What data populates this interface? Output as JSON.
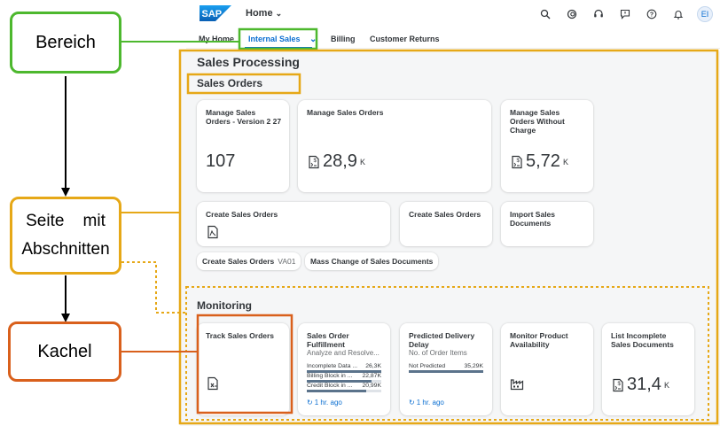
{
  "shell": {
    "logo_text": "SAP",
    "home_label": "Home",
    "user_initials": "EI",
    "icons": [
      "search-icon",
      "copilot-icon",
      "support-icon",
      "feedback-icon",
      "help-icon",
      "notifications-icon"
    ]
  },
  "tabs": [
    {
      "label": "My Home"
    },
    {
      "label": "Internal Sales",
      "active": true
    },
    {
      "label": "Billing"
    },
    {
      "label": "Customer Returns"
    }
  ],
  "page": {
    "title": "Sales Processing",
    "sections": {
      "sales_orders": {
        "title": "Sales Orders",
        "tiles": {
          "manage_v2": {
            "title": "Manage Sales Orders - Version 2 27",
            "number": "107"
          },
          "manage": {
            "title": "Manage Sales Orders",
            "number": "28,9",
            "unit": "K"
          },
          "manage_wo_charge": {
            "title": "Manage Sales Orders Without Charge",
            "number": "5,72",
            "unit": "K"
          },
          "create": {
            "title": "Create Sales Orders"
          },
          "create2": {
            "title": "Create Sales Orders"
          },
          "import": {
            "title": "Import Sales Documents"
          }
        },
        "links": {
          "create_va01": {
            "label": "Create Sales Orders",
            "suffix": "VA01"
          },
          "mass_change": {
            "label": "Mass Change of Sales Documents"
          }
        }
      },
      "monitoring": {
        "title": "Monitoring",
        "tiles": {
          "track": {
            "title": "Track Sales Orders"
          },
          "fulfillment": {
            "title": "Sales Order Fulfillment",
            "subtitle": "Analyze and Resolve...",
            "rows": [
              {
                "label": "Incomplete Data ...",
                "value": "26,3K",
                "fraction": 1.0
              },
              {
                "label": "Billing Block in ...",
                "value": "22,87K",
                "fraction": 0.87
              },
              {
                "label": "Credit Block in ...",
                "value": "20,99K",
                "fraction": 0.8
              }
            ],
            "refresh": "1 hr. ago"
          },
          "predicted": {
            "title": "Predicted Delivery Delay",
            "subtitle": "No. of Order Items",
            "rows": [
              {
                "label": "Not Predicted",
                "value": "35,29K",
                "fraction": 1.0
              }
            ],
            "refresh": "1 hr. ago"
          },
          "monitor_avail": {
            "title": "Monitor Product Availability"
          },
          "list_incomplete": {
            "title": "List Incomplete Sales Documents",
            "number": "31,4",
            "unit": "K"
          }
        }
      }
    }
  },
  "annotations": {
    "bereich": "Bereich",
    "seite_line1": "Seite    mit",
    "seite_line2": "Abschnitten",
    "kachel": "Kachel"
  },
  "colors": {
    "green": "#4db82e",
    "gold": "#e6a817",
    "orange": "#d9601c",
    "accent": "#0a6ed1"
  }
}
